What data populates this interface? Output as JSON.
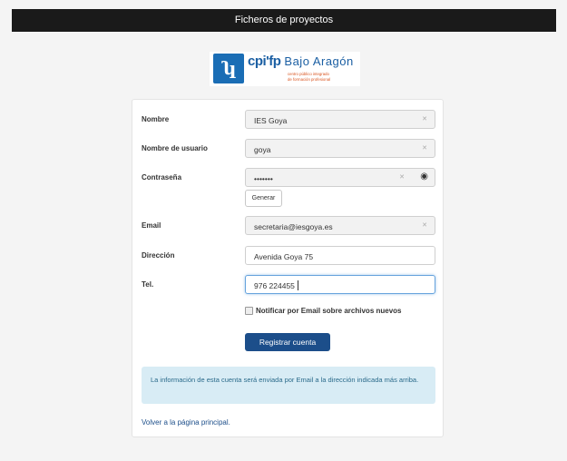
{
  "header": {
    "title": "Ficheros de proyectos"
  },
  "logo": {
    "brand": "cpi'fp",
    "name": "Bajo Aragón",
    "subtitle_line1": "centro público integrado",
    "subtitle_line2": "de formación profesional"
  },
  "form": {
    "nombre": {
      "label": "Nombre",
      "value": "IES Goya"
    },
    "usuario": {
      "label": "Nombre de usuario",
      "value": "goya"
    },
    "password": {
      "label": "Contraseña",
      "value": "•••••••",
      "generate_label": "Generar"
    },
    "email": {
      "label": "Email",
      "value": "secretaria@iesgoya.es"
    },
    "direccion": {
      "label": "Dirección",
      "value": "Avenida Goya 75"
    },
    "tel": {
      "label": "Tel.",
      "value": "976 224455"
    },
    "notify_label": "Notificar por Email sobre archivos nuevos",
    "notify_checked": false,
    "submit_label": "Registrar cuenta"
  },
  "info_text": "La información de esta cuenta será enviada por Email a la dirección indicada más arriba.",
  "back_link": "Volver a la página principal.",
  "colors": {
    "topbar": "#1a1a1a",
    "primary": "#1c4e8a",
    "info_bg": "#d8ecf5",
    "logo_blue": "#1a6db5",
    "logo_orange": "#d9531e"
  },
  "icons": {
    "clear": "clear-icon",
    "reveal": "eye-icon",
    "logo": "logo-icon"
  }
}
